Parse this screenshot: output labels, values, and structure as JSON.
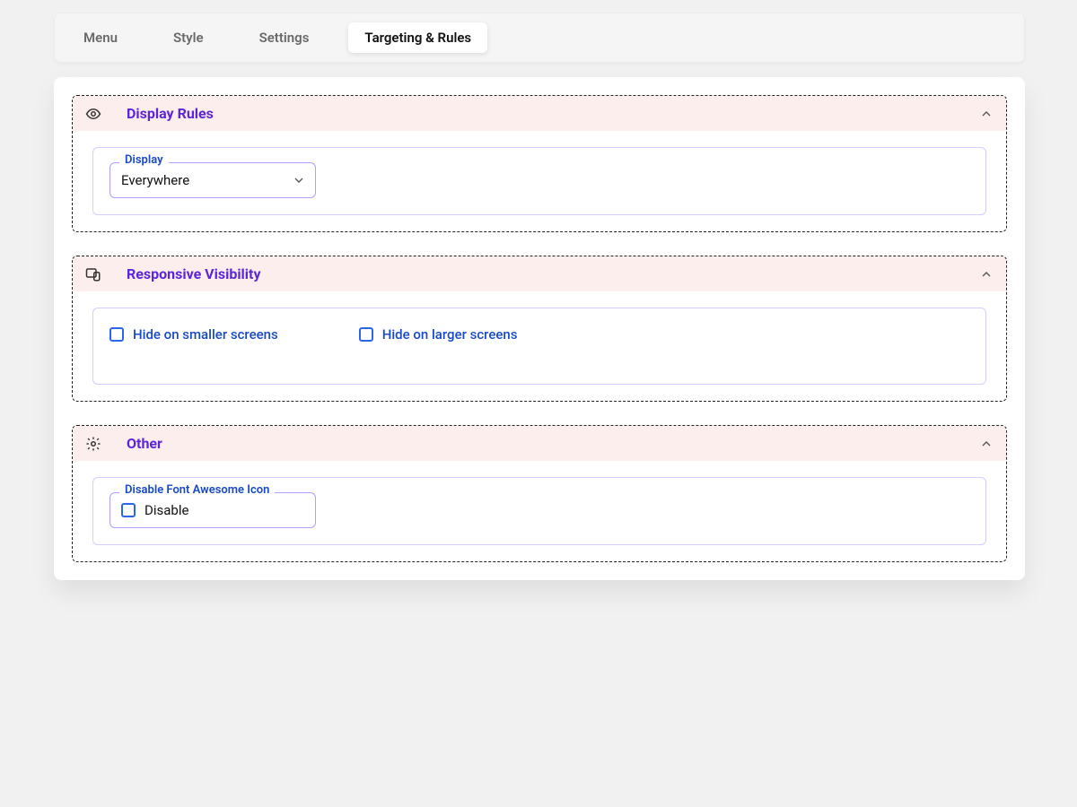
{
  "tabs": [
    {
      "label": "Menu",
      "active": false
    },
    {
      "label": "Style",
      "active": false
    },
    {
      "label": "Settings",
      "active": false
    },
    {
      "label": "Targeting & Rules",
      "active": true
    }
  ],
  "sections": {
    "display_rules": {
      "title": "Display Rules",
      "field_label": "Display",
      "selected_value": "Everywhere",
      "expanded": true
    },
    "responsive_visibility": {
      "title": "Responsive Visibility",
      "expanded": true,
      "checkboxes": {
        "hide_smaller": {
          "label": "Hide on smaller screens",
          "checked": false
        },
        "hide_larger": {
          "label": "Hide on larger screens",
          "checked": false
        }
      }
    },
    "other": {
      "title": "Other",
      "expanded": true,
      "disable_fa": {
        "legend": "Disable Font Awesome Icon",
        "label": "Disable",
        "checked": false
      }
    }
  }
}
